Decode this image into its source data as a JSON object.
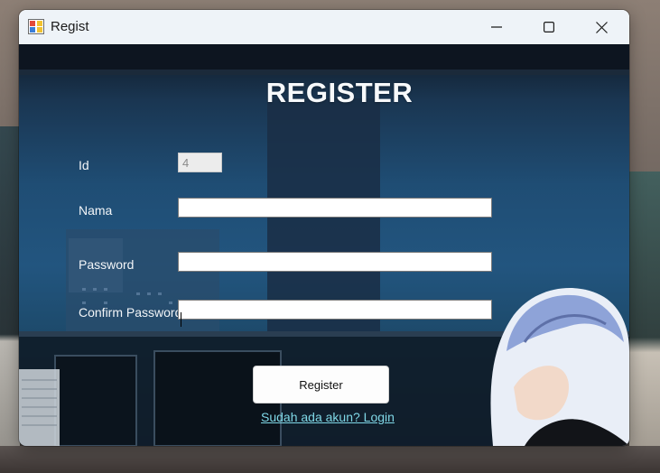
{
  "window": {
    "title": "Regist",
    "icons": {
      "app": "app-icon",
      "minimize": "minimize-icon",
      "maximize": "maximize-icon",
      "close": "close-icon"
    }
  },
  "form": {
    "heading": "REGISTER",
    "id_label": "Id",
    "id_value": "4",
    "nama_label": "Nama",
    "nama_value": "",
    "password_label": "Password",
    "password_value": "",
    "confirm_label": "Confirm Password",
    "confirm_value": "",
    "register_button": "Register",
    "login_link": "Sudah ada akun?  Login"
  },
  "colors": {
    "link": "#7fd7e6",
    "background": "#1f4d74"
  }
}
